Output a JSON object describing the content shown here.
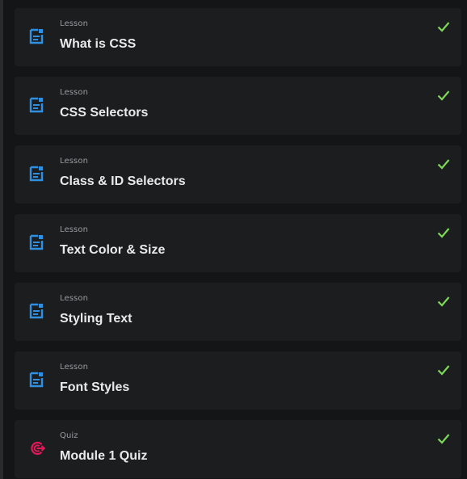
{
  "items": [
    {
      "type": "Lesson",
      "title": "What is CSS",
      "icon": "document-icon",
      "completed": true
    },
    {
      "type": "Lesson",
      "title": "CSS Selectors",
      "icon": "document-icon",
      "completed": true
    },
    {
      "type": "Lesson",
      "title": "Class & ID Selectors",
      "icon": "document-icon",
      "completed": true
    },
    {
      "type": "Lesson",
      "title": "Text Color & Size",
      "icon": "document-icon",
      "completed": true
    },
    {
      "type": "Lesson",
      "title": "Styling Text",
      "icon": "document-icon",
      "completed": true
    },
    {
      "type": "Lesson",
      "title": "Font Styles",
      "icon": "document-icon",
      "completed": true
    },
    {
      "type": "Quiz",
      "title": "Module 1 Quiz",
      "icon": "target-icon",
      "completed": true
    }
  ],
  "colors": {
    "background": "#141516",
    "card": "#1c1d1f",
    "lesson_icon": "#2f8fe0",
    "quiz_icon": "#e3195a",
    "check": "#7ed957",
    "title": "#e9e9ea",
    "type_label": "#9a9b9e"
  }
}
